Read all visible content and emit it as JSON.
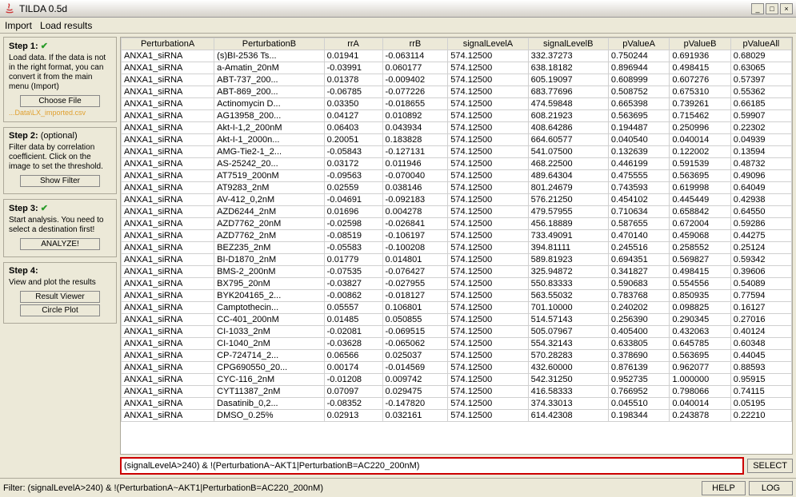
{
  "window": {
    "title": "TILDA 0.5d"
  },
  "menu": {
    "import": "Import",
    "load_results": "Load results"
  },
  "sidebar": {
    "step1": {
      "title": "Step 1:",
      "desc": "Load data. If the data is not in the right format, you can convert it from the main menu (Import)",
      "choose_file": "Choose File",
      "file_note": "...Data\\LX_imported.csv"
    },
    "step2": {
      "title": "Step 2:",
      "sub": "(optional)",
      "desc": "Filter data by correlation coefficient. Click on the image to set the threshold.",
      "show_filter": "Show Filter"
    },
    "step3": {
      "title": "Step 3:",
      "desc": "Start analysis. You need to select a destination first!",
      "analyze": "ANALYZE!"
    },
    "step4": {
      "title": "Step 4:",
      "desc": "View and plot the results",
      "result_viewer": "Result Viewer",
      "circle_plot": "Circle Plot"
    }
  },
  "table": {
    "headers": [
      "PerturbationA",
      "PerturbationB",
      "rrA",
      "rrB",
      "signalLevelA",
      "signalLevelB",
      "pValueA",
      "pValueB",
      "pValueAll"
    ],
    "rows": [
      [
        "ANXA1_siRNA",
        "(s)BI-2536 Ts...",
        "0.01941",
        "-0.063114",
        "574.12500",
        "332.37273",
        "0.750244",
        "0.691936",
        "0.68029"
      ],
      [
        "ANXA1_siRNA",
        "a-Amatin_20nM",
        "-0.03991",
        "0.060177",
        "574.12500",
        "638.18182",
        "0.896944",
        "0.498415",
        "0.63065"
      ],
      [
        "ANXA1_siRNA",
        "ABT-737_200...",
        "0.01378",
        "-0.009402",
        "574.12500",
        "605.19097",
        "0.608999",
        "0.607276",
        "0.57397"
      ],
      [
        "ANXA1_siRNA",
        "ABT-869_200...",
        "-0.06785",
        "-0.077226",
        "574.12500",
        "683.77696",
        "0.508752",
        "0.675310",
        "0.55362"
      ],
      [
        "ANXA1_siRNA",
        "Actinomycin D...",
        "0.03350",
        "-0.018655",
        "574.12500",
        "474.59848",
        "0.665398",
        "0.739261",
        "0.66185"
      ],
      [
        "ANXA1_siRNA",
        "AG13958_200...",
        "0.04127",
        "0.010892",
        "574.12500",
        "608.21923",
        "0.563695",
        "0.715462",
        "0.59907"
      ],
      [
        "ANXA1_siRNA",
        "Akt-I-1,2_200nM",
        "0.06403",
        "0.043934",
        "574.12500",
        "408.64286",
        "0.194487",
        "0.250996",
        "0.22302"
      ],
      [
        "ANXA1_siRNA",
        "Akt-I-1_2000n...",
        "0.20051",
        "0.183828",
        "574.12500",
        "664.60577",
        "0.040540",
        "0.040014",
        "0.04939"
      ],
      [
        "ANXA1_siRNA",
        "AMG-Tie2-1_2...",
        "-0.05843",
        "-0.127131",
        "574.12500",
        "541.07500",
        "0.132639",
        "0.122002",
        "0.13594"
      ],
      [
        "ANXA1_siRNA",
        "AS-25242_20...",
        "0.03172",
        "0.011946",
        "574.12500",
        "468.22500",
        "0.446199",
        "0.591539",
        "0.48732"
      ],
      [
        "ANXA1_siRNA",
        "AT7519_200nM",
        "-0.09563",
        "-0.070040",
        "574.12500",
        "489.64304",
        "0.475555",
        "0.563695",
        "0.49096"
      ],
      [
        "ANXA1_siRNA",
        "AT9283_2nM",
        "0.02559",
        "0.038146",
        "574.12500",
        "801.24679",
        "0.743593",
        "0.619998",
        "0.64049"
      ],
      [
        "ANXA1_siRNA",
        "AV-412_0,2nM",
        "-0.04691",
        "-0.092183",
        "574.12500",
        "576.21250",
        "0.454102",
        "0.445449",
        "0.42938"
      ],
      [
        "ANXA1_siRNA",
        "AZD6244_2nM",
        "0.01696",
        "0.004278",
        "574.12500",
        "479.57955",
        "0.710634",
        "0.658842",
        "0.64550"
      ],
      [
        "ANXA1_siRNA",
        "AZD7762_20nM",
        "-0.02598",
        "-0.026841",
        "574.12500",
        "456.18889",
        "0.587655",
        "0.672004",
        "0.59286"
      ],
      [
        "ANXA1_siRNA",
        "AZD7762_2nM",
        "-0.08519",
        "-0.106197",
        "574.12500",
        "733.49091",
        "0.470140",
        "0.459068",
        "0.44275"
      ],
      [
        "ANXA1_siRNA",
        "BEZ235_2nM",
        "-0.05583",
        "-0.100208",
        "574.12500",
        "394.81111",
        "0.245516",
        "0.258552",
        "0.25124"
      ],
      [
        "ANXA1_siRNA",
        "BI-D1870_2nM",
        "0.01779",
        "0.014801",
        "574.12500",
        "589.81923",
        "0.694351",
        "0.569827",
        "0.59342"
      ],
      [
        "ANXA1_siRNA",
        "BMS-2_200nM",
        "-0.07535",
        "-0.076427",
        "574.12500",
        "325.94872",
        "0.341827",
        "0.498415",
        "0.39606"
      ],
      [
        "ANXA1_siRNA",
        "BX795_20nM",
        "-0.03827",
        "-0.027955",
        "574.12500",
        "550.83333",
        "0.590683",
        "0.554556",
        "0.54089"
      ],
      [
        "ANXA1_siRNA",
        "BYK204165_2...",
        "-0.00862",
        "-0.018127",
        "574.12500",
        "563.55032",
        "0.783768",
        "0.850935",
        "0.77594"
      ],
      [
        "ANXA1_siRNA",
        "Camptothecin...",
        "0.05557",
        "0.106801",
        "574.12500",
        "701.10000",
        "0.240202",
        "0.098825",
        "0.16127"
      ],
      [
        "ANXA1_siRNA",
        "CC-401_200nM",
        "0.01485",
        "0.050855",
        "574.12500",
        "514.57143",
        "0.256390",
        "0.290345",
        "0.27016"
      ],
      [
        "ANXA1_siRNA",
        "CI-1033_2nM",
        "-0.02081",
        "-0.069515",
        "574.12500",
        "505.07967",
        "0.405400",
        "0.432063",
        "0.40124"
      ],
      [
        "ANXA1_siRNA",
        "CI-1040_2nM",
        "-0.03628",
        "-0.065062",
        "574.12500",
        "554.32143",
        "0.633805",
        "0.645785",
        "0.60348"
      ],
      [
        "ANXA1_siRNA",
        "CP-724714_2...",
        "0.06566",
        "0.025037",
        "574.12500",
        "570.28283",
        "0.378690",
        "0.563695",
        "0.44045"
      ],
      [
        "ANXA1_siRNA",
        "CPG690550_20...",
        "0.00174",
        "-0.014569",
        "574.12500",
        "432.60000",
        "0.876139",
        "0.962077",
        "0.88593"
      ],
      [
        "ANXA1_siRNA",
        "CYC-116_2nM",
        "-0.01208",
        "0.009742",
        "574.12500",
        "542.31250",
        "0.952735",
        "1.000000",
        "0.95915"
      ],
      [
        "ANXA1_siRNA",
        "CYT11387_2nM",
        "0.07097",
        "0.029475",
        "574.12500",
        "416.58333",
        "0.766952",
        "0.798066",
        "0.74115"
      ],
      [
        "ANXA1_siRNA",
        "Dasatinib_0,2...",
        "-0.08352",
        "-0.147820",
        "574.12500",
        "374.33013",
        "0.045510",
        "0.040014",
        "0.05195"
      ],
      [
        "ANXA1_siRNA",
        "DMSO_0.25%",
        "0.02913",
        "0.032161",
        "574.12500",
        "614.42308",
        "0.198344",
        "0.243878",
        "0.22210"
      ]
    ]
  },
  "filter": {
    "value": "(signalLevelA>240) & !(PerturbationA~AKT1|PerturbationB=AC220_200nM)",
    "select_label": "SELECT"
  },
  "status": {
    "text": "Filter: (signalLevelA>240) & !(PerturbationA~AKT1|PerturbationB=AC220_200nM)",
    "help": "HELP",
    "log": "LOG"
  }
}
